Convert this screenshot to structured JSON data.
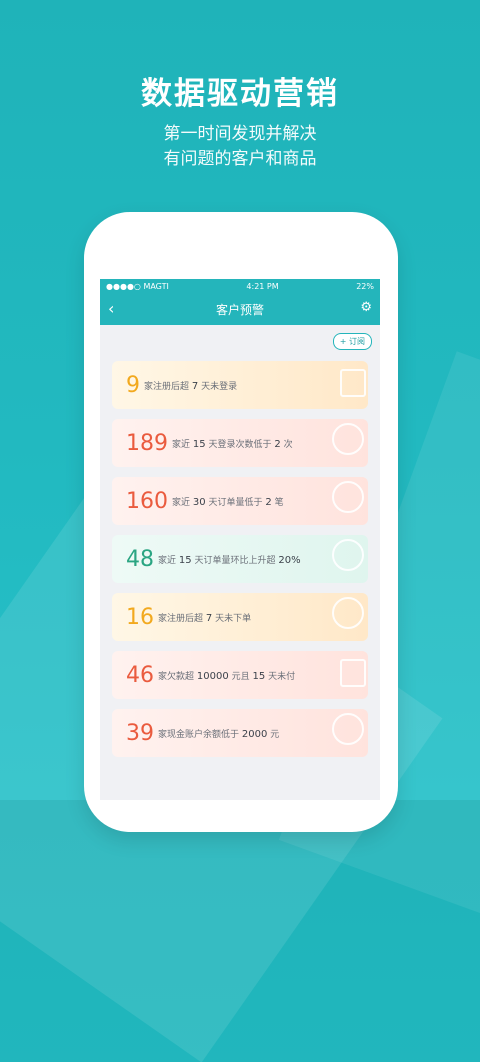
{
  "hero": {
    "title": "数据驱动营销",
    "subtitle_line1": "第一时间发现并解决",
    "subtitle_line2": "有问题的客户和商品"
  },
  "status": {
    "carrier": "●●●●○ MAGTI",
    "time": "4:21 PM",
    "battery": "22%"
  },
  "nav": {
    "back_icon": "‹",
    "title": "客户预警",
    "settings_icon": "⚙"
  },
  "subscribe": "+ 订阅",
  "cards": [
    {
      "num": "9",
      "p1": "家注册后超",
      "v1": "7",
      "p2": "天未登录",
      "v2": "",
      "p3": "",
      "colors": [
        "#fff7e6",
        "#ffe8c8"
      ],
      "numColor": "#f2a91e"
    },
    {
      "num": "189",
      "p1": "家近",
      "v1": "15",
      "p2": "天登录次数低于",
      "v2": "2",
      "p3": "次",
      "colors": [
        "#fff2ef",
        "#ffe3dd"
      ],
      "numColor": "#ea5b3e"
    },
    {
      "num": "160",
      "p1": "家近",
      "v1": "30",
      "p2": "天订单量低于",
      "v2": "2",
      "p3": "笔",
      "colors": [
        "#fff2ef",
        "#ffe3dd"
      ],
      "numColor": "#ea5b3e"
    },
    {
      "num": "48",
      "p1": "家近",
      "v1": "15",
      "p2": "天订单量环比上升超",
      "v2": "20%",
      "p3": "",
      "colors": [
        "#eefaf6",
        "#dff5ee"
      ],
      "numColor": "#2aa582"
    },
    {
      "num": "16",
      "p1": "家注册后超",
      "v1": "7",
      "p2": "天未下单",
      "v2": "",
      "p3": "",
      "colors": [
        "#fff7e6",
        "#ffe8c8"
      ],
      "numColor": "#f2a91e"
    },
    {
      "num": "46",
      "p1": "家欠款超",
      "v1": "10000",
      "p2": "元且",
      "v2": "15",
      "p3": "天未付",
      "colors": [
        "#fff2ef",
        "#ffe3dd"
      ],
      "numColor": "#ea5b3e"
    },
    {
      "num": "39",
      "p1": "家现金账户余额低于",
      "v1": "2000",
      "p2": "元",
      "v2": "",
      "p3": "",
      "colors": [
        "#fff2ef",
        "#ffe3dd"
      ],
      "numColor": "#ea5b3e"
    }
  ]
}
